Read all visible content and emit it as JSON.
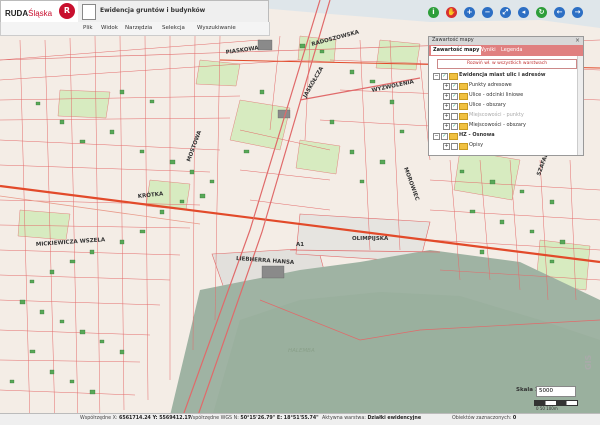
{
  "app": {
    "logo_main": "RUDA",
    "logo_suffix": "Śląska",
    "title": "Ewidencja gruntów i budynków"
  },
  "menu": [
    "Plik",
    "Widok",
    "Narzędzia",
    "Selekcja",
    "Wyszukiwanie"
  ],
  "toolbar": [
    {
      "icon": "info-icon",
      "glyph": "i",
      "color": "#2e9e3a"
    },
    {
      "icon": "hand-pan-icon",
      "glyph": "✋",
      "color": "#d83030"
    },
    {
      "icon": "zoom-in-icon",
      "glyph": "+",
      "color": "#2d6fc4"
    },
    {
      "icon": "zoom-out-icon",
      "glyph": "−",
      "color": "#2d6fc4"
    },
    {
      "icon": "zoom-extent-icon",
      "glyph": "⤢",
      "color": "#2d6fc4"
    },
    {
      "icon": "zoom-previous-icon",
      "glyph": "◂",
      "color": "#2d6fc4"
    },
    {
      "icon": "refresh-icon",
      "glyph": "↻",
      "color": "#2e9e3a"
    },
    {
      "icon": "back-icon",
      "glyph": "←",
      "color": "#2d6fc4"
    },
    {
      "icon": "forward-icon",
      "glyph": "→",
      "color": "#2d6fc4"
    }
  ],
  "panel": {
    "title": "Zawartość mapy",
    "close": "×",
    "tabs": [
      "Zawartość mapy",
      "Wyniki",
      "Legenda"
    ],
    "reset_label": "Rozwiń wł. w wszystkich warstwach",
    "layers": [
      {
        "label": "Ewidencja miast ulic i adresów",
        "bold": true,
        "level": 0,
        "checked": true,
        "dim": false
      },
      {
        "label": "Punkty adresowe",
        "bold": false,
        "level": 1,
        "checked": true,
        "dim": false
      },
      {
        "label": "Ulice - odcinki liniowe",
        "bold": false,
        "level": 1,
        "checked": true,
        "dim": false
      },
      {
        "label": "Ulice - obszary",
        "bold": false,
        "level": 1,
        "checked": true,
        "dim": false
      },
      {
        "label": "Miejscowości - punkty",
        "bold": false,
        "level": 1,
        "checked": false,
        "dim": true
      },
      {
        "label": "Miejscowości - obszary",
        "bold": false,
        "level": 1,
        "checked": true,
        "dim": false
      },
      {
        "label": "HZ - Osnowa",
        "bold": true,
        "level": 0,
        "checked": true,
        "dim": false
      },
      {
        "label": "Opisy",
        "bold": false,
        "level": 1,
        "checked": false,
        "dim": false
      }
    ]
  },
  "streets": {
    "piaskowa": "PIASKOWA",
    "radoszowska": "RADOSZOWSKA",
    "jaskolcza": "JASKÓŁCZA",
    "wyzwolenia": "WYZWOLENIA",
    "mostowa": "MOSTOWA",
    "krotka": "KRÓTKA",
    "olimpijska": "OLIMPIJSKA",
    "a1": "A1",
    "liebherra": "LIEBHERRA HANSA",
    "mickiewicza": "MICKIEWICZA WSZELA",
    "halemba": "HALEMBA",
    "morowiec": "MOROWIEC",
    "szafarnia": "SZAFARNIA"
  },
  "scale": {
    "label": "Skala 1:",
    "value": "5000",
    "bar_text": "0   50   100m"
  },
  "gis": "GIS",
  "status": {
    "coord_label": "Współrzędne X:",
    "coord_value": "6561714.24 Y: 5569412.17",
    "wgs_label": "Współrzędne WGS N:",
    "wgs_value": "50°15'26.79\" E: 18°51'55.74\"",
    "layer_label": "Aktywna warstwa:",
    "layer_value": "Działki ewidencyjne",
    "sel_label": "Obiektów zaznaczonych:",
    "sel_value": "0"
  }
}
